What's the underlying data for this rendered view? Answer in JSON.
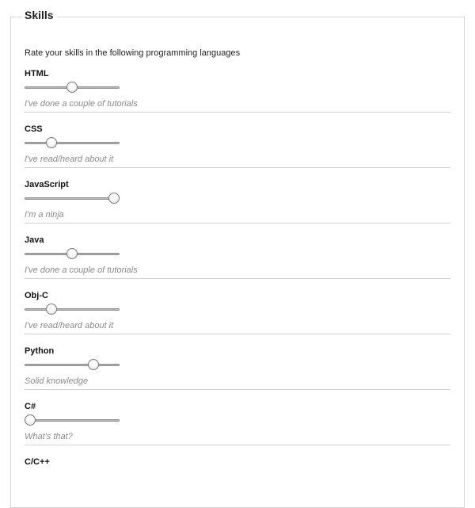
{
  "section": {
    "legend": "Skills",
    "intro": "Rate your skills in the following programming languages"
  },
  "skills": [
    {
      "name": "HTML",
      "level": 0.5,
      "description": "I've done a couple of tutorials"
    },
    {
      "name": "CSS",
      "level": 0.25,
      "description": "I've read/heard about it"
    },
    {
      "name": "JavaScript",
      "level": 1.0,
      "description": "I'm a ninja"
    },
    {
      "name": "Java",
      "level": 0.5,
      "description": "I've done a couple of tutorials"
    },
    {
      "name": "Obj-C",
      "level": 0.25,
      "description": "I've read/heard about it"
    },
    {
      "name": "Python",
      "level": 0.75,
      "description": "Solid knowledge"
    },
    {
      "name": "C#",
      "level": 0.0,
      "description": "What's that?"
    },
    {
      "name": "C/C++",
      "level": null,
      "description": ""
    }
  ]
}
